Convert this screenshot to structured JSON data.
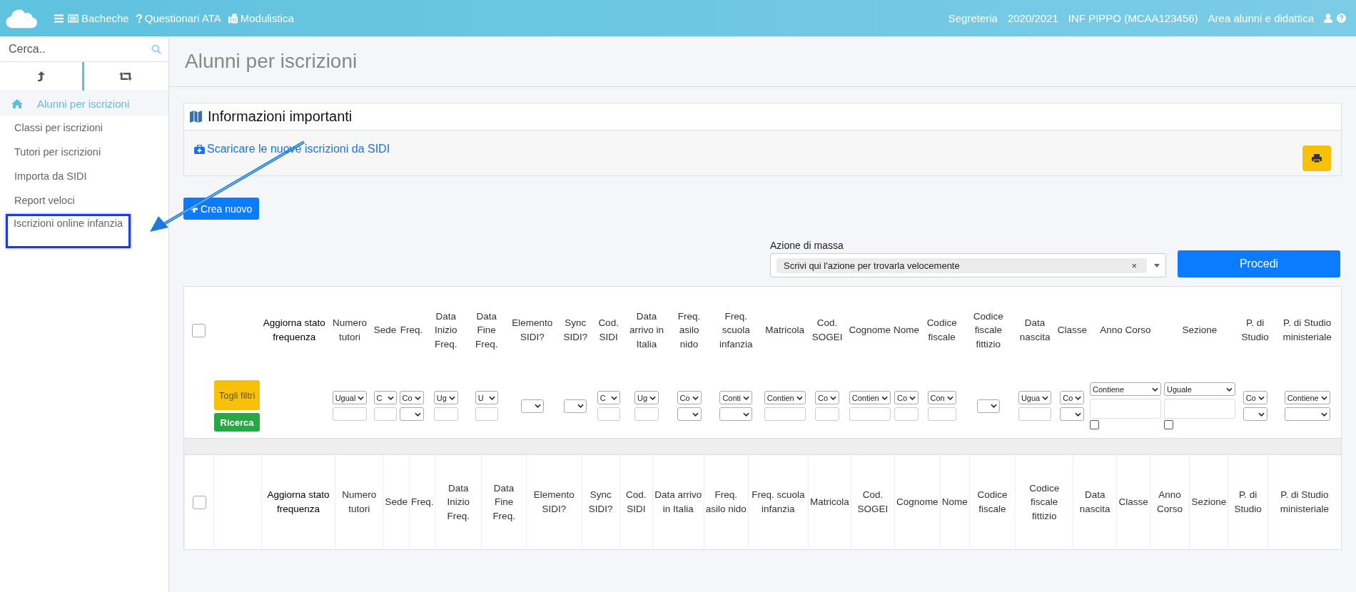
{
  "header": {
    "nav": [
      {
        "label": "Bacheche"
      },
      {
        "label": "Questionari ATA"
      },
      {
        "label": "Modulistica"
      }
    ],
    "info": [
      "Segreteria",
      "2020/2021",
      "INF PIPPO (MCAA123456)",
      "Area alunni e didattica"
    ]
  },
  "sidebar": {
    "search": {
      "placeholder": "Cerca.."
    },
    "tabs": [
      {
        "selected": true
      },
      {
        "selected": false
      }
    ],
    "items": [
      {
        "label": "Alunni per iscrizioni",
        "selected": true,
        "highlighted": false
      },
      {
        "label": "Classi per iscrizioni",
        "selected": false,
        "highlighted": false
      },
      {
        "label": "Tutori per iscrizioni",
        "selected": false,
        "highlighted": false
      },
      {
        "label": "Importa da SIDI",
        "selected": false,
        "highlighted": false
      },
      {
        "label": "Report veloci",
        "selected": false,
        "highlighted": false
      },
      {
        "label": "Iscrizioni online infanzia",
        "selected": false,
        "highlighted": true
      }
    ]
  },
  "page": {
    "title": "Alunni per iscrizioni"
  },
  "info_panel": {
    "title": "Informazioni importanti",
    "link": "Scaricare le nuove iscrizioni da SIDI"
  },
  "create_button": "Crea nuovo",
  "mass_action": {
    "label": "Azione di massa",
    "value": "Scrivi qui l'azione per trovarla velocemente",
    "clear": "×",
    "button": "Procedi"
  },
  "table": {
    "select_all_checked": false,
    "clear_filters": "Togli filtri",
    "search": "Ricerca",
    "columns": [
      {
        "label": "Aggiorna stato frequenza",
        "kind": "action",
        "filter": {
          "kind": "none"
        }
      },
      {
        "label": "Numero tutori",
        "kind": "field",
        "filter": {
          "kind": "select-input",
          "operator": "Ugual"
        }
      },
      {
        "label": "Sede",
        "kind": "field",
        "filter": {
          "kind": "select-input",
          "operator": "C"
        }
      },
      {
        "label": "Freq.",
        "kind": "field",
        "filter": {
          "kind": "select-select",
          "operator": "Co"
        }
      },
      {
        "label": "Data Inizio Freq.",
        "kind": "field",
        "filter": {
          "kind": "select-input",
          "operator": "Ug"
        }
      },
      {
        "label": "Data Fine Freq.",
        "kind": "field",
        "filter": {
          "kind": "select-input",
          "operator": "U"
        }
      },
      {
        "label": "Elemento SIDI?",
        "kind": "field",
        "filter": {
          "kind": "select"
        }
      },
      {
        "label": "Sync SIDI?",
        "kind": "field",
        "filter": {
          "kind": "select"
        }
      },
      {
        "label": "Cod. SIDI",
        "kind": "field",
        "filter": {
          "kind": "select-input",
          "operator": "C"
        }
      },
      {
        "label": "Data arrivo in Italia",
        "kind": "field",
        "filter": {
          "kind": "select-input",
          "operator": "Ug"
        }
      },
      {
        "label": "Freq. asilo nido",
        "kind": "field",
        "filter": {
          "kind": "select-select",
          "operator": "Co"
        }
      },
      {
        "label": "Freq. scuola infanzia",
        "kind": "field",
        "filter": {
          "kind": "select-select",
          "operator": "Conti"
        }
      },
      {
        "label": "Matricola",
        "kind": "field",
        "filter": {
          "kind": "select-input",
          "operator": "Contien"
        }
      },
      {
        "label": "Cod. SOGEI",
        "kind": "field",
        "filter": {
          "kind": "select-input",
          "operator": "Co"
        }
      },
      {
        "label": "Cognome",
        "kind": "field",
        "filter": {
          "kind": "select-input",
          "operator": "Contien"
        }
      },
      {
        "label": "Nome",
        "kind": "field",
        "filter": {
          "kind": "select-input",
          "operator": "Co"
        }
      },
      {
        "label": "Codice fiscale",
        "kind": "field",
        "filter": {
          "kind": "select-input",
          "operator": "Con"
        }
      },
      {
        "label": "Codice fiscale fittizio",
        "kind": "field",
        "filter": {
          "kind": "select"
        }
      },
      {
        "label": "Data nascita",
        "kind": "field",
        "filter": {
          "kind": "select-input",
          "operator": "Ugua"
        }
      },
      {
        "label": "Classe",
        "kind": "field",
        "filter": {
          "kind": "select-select",
          "operator": "Co"
        }
      },
      {
        "label": "Anno Corso",
        "kind": "field",
        "filter": {
          "kind": "select-area",
          "operator": "Contiene",
          "checked": false
        }
      },
      {
        "label": "Sezione",
        "kind": "field",
        "filter": {
          "kind": "select-area",
          "operator": "Uguale",
          "checked": false
        }
      },
      {
        "label": "P. di Studio",
        "kind": "field",
        "filter": {
          "kind": "select-select",
          "operator": "Co"
        }
      },
      {
        "label": "P. di Studio ministeriale",
        "kind": "field",
        "filter": {
          "kind": "select-select",
          "operator": "Contiene"
        }
      }
    ],
    "footer": {
      "select_all_checked": false,
      "columns": [
        {
          "label": "Aggiorna stato frequenza",
          "kind": "action"
        },
        {
          "label": "Numero tutori",
          "kind": "field"
        },
        {
          "label": "Sede",
          "kind": "field"
        },
        {
          "label": "Freq.",
          "kind": "field"
        },
        {
          "label": "Data Inizio Freq.",
          "kind": "field"
        },
        {
          "label": "Data Fine Freq.",
          "kind": "field"
        },
        {
          "label": "Elemento SIDI?",
          "kind": "field"
        },
        {
          "label": "Sync SIDI?",
          "kind": "field"
        },
        {
          "label": "Cod. SIDI",
          "kind": "field"
        },
        {
          "label": "Data arrivo in Italia",
          "kind": "field"
        },
        {
          "label": "Freq. asilo nido",
          "kind": "field"
        },
        {
          "label": "Freq. scuola infanzia",
          "kind": "field"
        },
        {
          "label": "Matricola",
          "kind": "field"
        },
        {
          "label": "Cod. SOGEI",
          "kind": "field"
        },
        {
          "label": "Cognome",
          "kind": "field"
        },
        {
          "label": "Nome",
          "kind": "field"
        },
        {
          "label": "Codice fiscale",
          "kind": "field"
        },
        {
          "label": "Codice fiscale fittizio",
          "kind": "field"
        },
        {
          "label": "Data nascita",
          "kind": "field"
        },
        {
          "label": "Classe",
          "kind": "field"
        },
        {
          "label": "Anno Corso",
          "kind": "field"
        },
        {
          "label": "Sezione",
          "kind": "field"
        },
        {
          "label": "P. di Studio",
          "kind": "field"
        },
        {
          "label": "P. di Studio ministeriale",
          "kind": "field"
        }
      ]
    }
  }
}
